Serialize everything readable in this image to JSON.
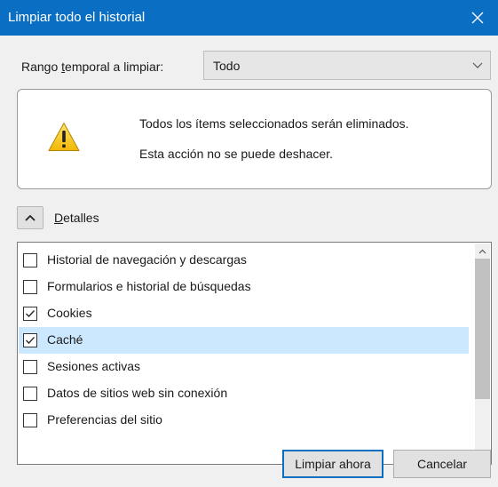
{
  "window": {
    "title": "Limpiar todo el historial",
    "close_icon": "close-icon"
  },
  "range": {
    "label_prefix": "Rango ",
    "label_accel": "t",
    "label_suffix": "emporal a limpiar:",
    "value": "Todo",
    "chevron_icon": "chevron-down-icon"
  },
  "warning": {
    "icon": "warning-icon",
    "line1": "Todos los ítems seleccionados serán eliminados.",
    "line2": "Esta acción no se puede deshacer."
  },
  "details": {
    "toggle_icon": "chevron-up-icon",
    "label_accel": "D",
    "label_rest": "etalles"
  },
  "items": [
    {
      "label": "Historial de navegación y descargas",
      "checked": false,
      "selected": false
    },
    {
      "label": "Formularios e historial de búsquedas",
      "checked": false,
      "selected": false
    },
    {
      "label": "Cookies",
      "checked": true,
      "selected": false
    },
    {
      "label": "Caché",
      "checked": true,
      "selected": true
    },
    {
      "label": "Sesiones activas",
      "checked": false,
      "selected": false
    },
    {
      "label": "Datos de sitios web sin conexión",
      "checked": false,
      "selected": false
    },
    {
      "label": "Preferencias del sitio",
      "checked": false,
      "selected": false
    }
  ],
  "buttons": {
    "confirm": "Limpiar ahora",
    "cancel": "Cancelar"
  },
  "colors": {
    "titlebar": "#0a6fc2",
    "selected_row": "#cce8ff",
    "warning_yellow": "#f6c915"
  }
}
